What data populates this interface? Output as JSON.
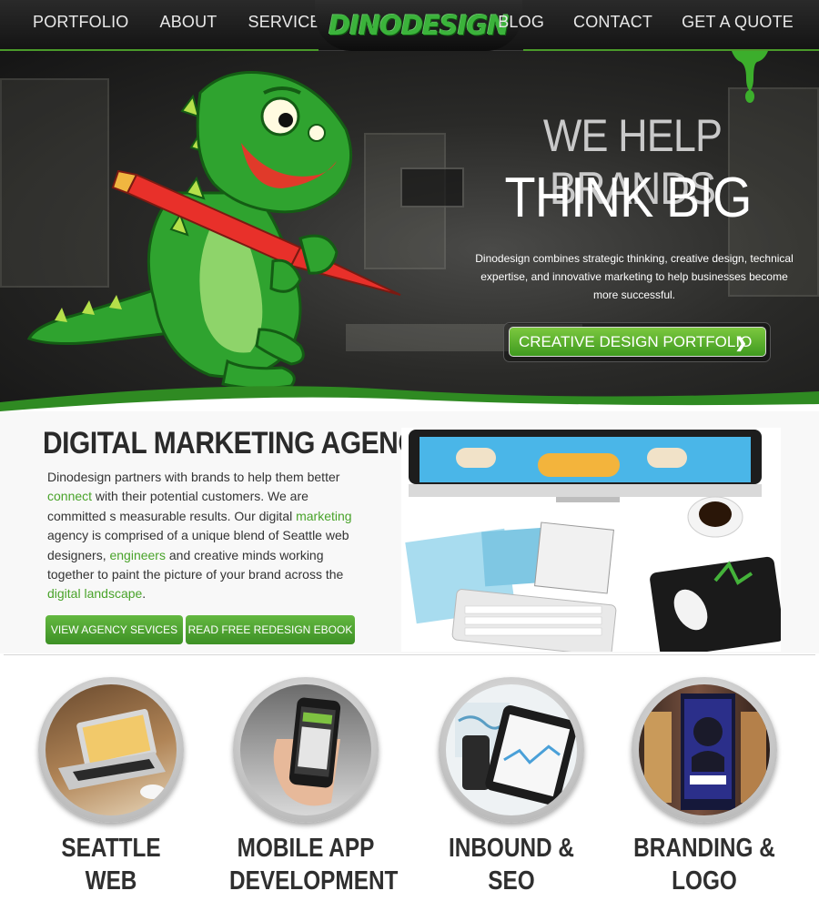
{
  "nav": {
    "left": [
      "PORTFOLIO",
      "ABOUT",
      "SERVICES"
    ],
    "logo": "DINODESIGN",
    "right": [
      "BLOG",
      "CONTACT",
      "GET A QUOTE"
    ]
  },
  "hero": {
    "title_line1": "WE HELP BRANDS",
    "title_line2": "THINK BIG",
    "text": "Dinodesign combines strategic thinking, creative design, technical expertise, and innovative marketing to help businesses become more successful.",
    "cta_label": "CREATIVE DESIGN PORTFOLIO"
  },
  "agency": {
    "title": "DIGITAL MARKETING AGENCY",
    "p1": "Dinodesign partners with brands to help them better ",
    "h1": "connect",
    "p2": " with their potential customers. We  are committed s measurable results. Our digital ",
    "h2": "marketing",
    "p3": " agency is comprised of a unique blend of Seattle web designers, ",
    "h3": "engineers",
    "p4": " and creative minds working together to paint the picture of your brand across the ",
    "h4": "digital landscape",
    "p5": ".",
    "btn1": "VIEW AGENCY SEVICES",
    "btn2": "READ FREE REDESIGN EBOOK"
  },
  "services": [
    {
      "label": "SEATTLE WEB\nDESIGN"
    },
    {
      "label": "MOBILE APP\nDEVELOPMENT"
    },
    {
      "label": "INBOUND & SEO\nMARKETING"
    },
    {
      "label": "BRANDING & LOGO\nDESIGN"
    }
  ],
  "colors": {
    "accent": "#49a32a",
    "nav_bg": "#1c1c1c",
    "dino_green": "#2fa32f"
  }
}
